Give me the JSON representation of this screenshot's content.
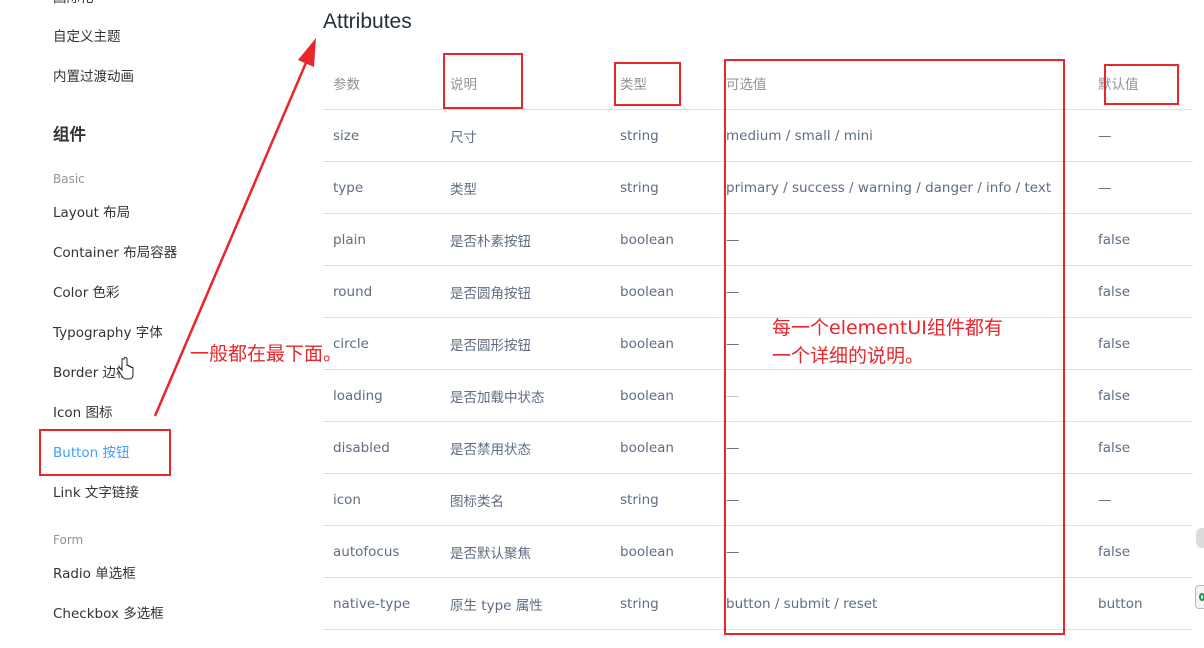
{
  "sidebar": {
    "cut_top_item": "国际化",
    "top_items": [
      "自定义主题",
      "内置过渡动画"
    ],
    "group_title": "组件",
    "categories": {
      "basic": "Basic",
      "form": "Form"
    },
    "basic_items": [
      "Layout 布局",
      "Container 布局容器",
      "Color 色彩",
      "Typography 字体",
      "Border 边框",
      "Icon 图标",
      "Button 按钮",
      "Link 文字链接"
    ],
    "form_items": [
      "Radio 单选框",
      "Checkbox 多选框"
    ],
    "active_item": "Button 按钮"
  },
  "section_title": "Attributes",
  "table": {
    "headers": [
      "参数",
      "说明",
      "类型",
      "可选值",
      "默认值"
    ],
    "rows": [
      [
        "size",
        "尺寸",
        "string",
        "medium / small / mini",
        "—"
      ],
      [
        "type",
        "类型",
        "string",
        "primary / success / warning / danger / info / text",
        "—"
      ],
      [
        "plain",
        "是否朴素按钮",
        "boolean",
        "—",
        "false"
      ],
      [
        "round",
        "是否圆角按钮",
        "boolean",
        "—",
        "false"
      ],
      [
        "circle",
        "是否圆形按钮",
        "boolean",
        "—",
        "false"
      ],
      [
        "loading",
        "是否加载中状态",
        "boolean",
        "—",
        "false"
      ],
      [
        "disabled",
        "是否禁用状态",
        "boolean",
        "—",
        "false"
      ],
      [
        "icon",
        "图标类名",
        "string",
        "—",
        "—"
      ],
      [
        "autofocus",
        "是否默认聚焦",
        "boolean",
        "—",
        "false"
      ],
      [
        "native-type",
        "原生 type 属性",
        "string",
        "button / submit / reset",
        "button"
      ]
    ]
  },
  "annotations": {
    "left_note": "一般都在最下面。",
    "table_note_line1": "每一个elementUI组件都有",
    "table_note_line2": "一个详细的说明。"
  },
  "colors": {
    "annotation_red": "#e8262b",
    "active_link": "#409eff",
    "border": "#dcdfe6"
  }
}
